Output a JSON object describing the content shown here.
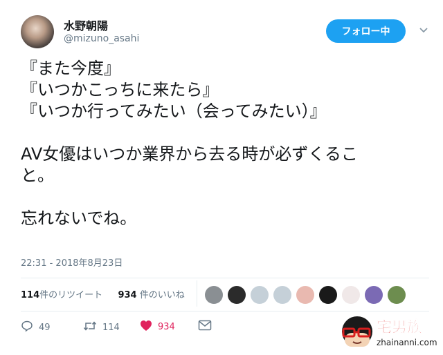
{
  "header": {
    "display_name": "水野朝陽",
    "handle": "@mizuno_asahi",
    "follow_label": "フォロー中"
  },
  "tweet": {
    "lines": [
      "『また今度』",
      "『いつかこっちに来たら』",
      "『いつか行ってみたい（会ってみたい）』",
      "",
      "AV女優はいつか業界から去る時が必ずくるこ",
      "と。",
      "",
      "忘れないでね。"
    ],
    "timestamp": "22:31 - 2018年8月23日"
  },
  "stats": {
    "retweets_count": "114",
    "retweets_label": "件のリツイート",
    "likes_count": "934",
    "likes_label": "件のいいね"
  },
  "likers": [
    {
      "name": "liker-avatar-1",
      "color": "#8a8f93"
    },
    {
      "name": "liker-avatar-2",
      "color": "#2b2b2b"
    },
    {
      "name": "liker-avatar-3",
      "color": "#c5d0d8"
    },
    {
      "name": "liker-avatar-4",
      "color": "#c5d0d8"
    },
    {
      "name": "liker-avatar-5",
      "color": "#e9b9b0"
    },
    {
      "name": "liker-avatar-6",
      "color": "#1a1a1a"
    },
    {
      "name": "liker-avatar-7",
      "color": "#f0e8e8"
    },
    {
      "name": "liker-avatar-8",
      "color": "#7b6ab4"
    },
    {
      "name": "liker-avatar-9",
      "color": "#6d8d4f"
    }
  ],
  "actions": {
    "reply_count": "49",
    "retweet_count": "114",
    "like_count": "934"
  },
  "watermark": {
    "text": "宅男族",
    "url": "zhainanni.com"
  },
  "colors": {
    "accent": "#1da1f2",
    "like": "#e0245e",
    "muted": "#657786"
  }
}
